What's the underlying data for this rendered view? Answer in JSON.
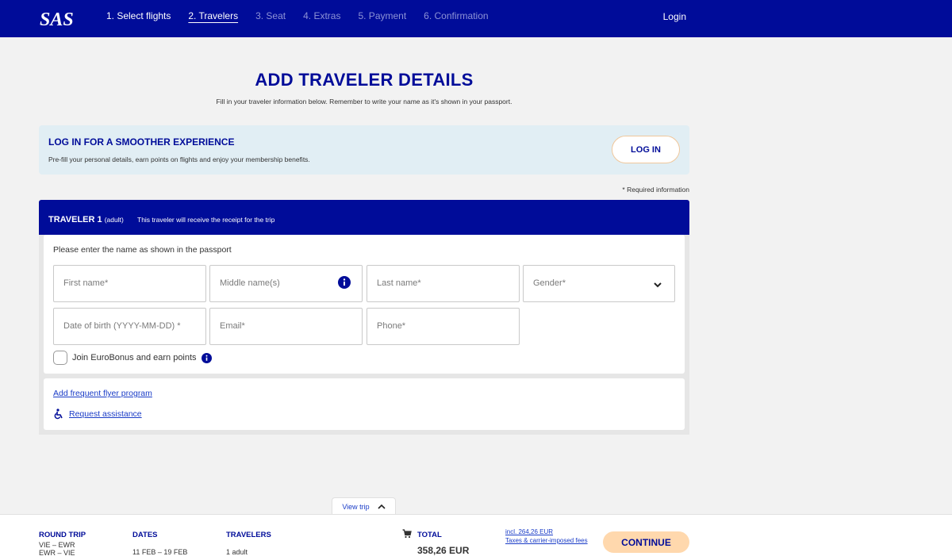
{
  "header": {
    "logo_text": "SAS",
    "steps": [
      {
        "label": "1. Select flights",
        "state": "done"
      },
      {
        "label": "2. Travelers",
        "state": "current"
      },
      {
        "label": "3. Seat",
        "state": "future"
      },
      {
        "label": "4. Extras",
        "state": "future"
      },
      {
        "label": "5. Payment",
        "state": "future"
      },
      {
        "label": "6. Confirmation",
        "state": "future"
      }
    ],
    "login_label": "Login"
  },
  "page": {
    "title": "ADD TRAVELER DETAILS",
    "subtitle": "Fill in your traveler information below. Remember to write your name as it's shown in your passport."
  },
  "login_banner": {
    "title": "LOG IN FOR A SMOOTHER EXPERIENCE",
    "text": "Pre-fill your personal details, earn points on flights and enjoy your membership benefits.",
    "button": "LOG IN"
  },
  "required_note": "* Required information",
  "traveler": {
    "title": "TRAVELER 1",
    "type": "(adult)",
    "note": "This traveler will receive the receipt for the trip",
    "hint": "Please enter the name as shown in the passport",
    "fields": {
      "first_name": "First name*",
      "middle_name": "Middle name(s)",
      "last_name": "Last name*",
      "gender": "Gender*",
      "dob": "Date of birth (YYYY-MM-DD) *",
      "email": "Email*",
      "phone": "Phone*"
    },
    "eurobonus_label": "Join EuroBonus and earn points",
    "frequent_flyer_link": "Add frequent flyer program",
    "assistance_link": "Request assistance"
  },
  "bottom_bar": {
    "view_trip": "View trip",
    "trip_label": "ROUND TRIP",
    "route_out": "VIE – EWR",
    "route_back": "EWR – VIE",
    "dates_label": "DATES",
    "dates_value": "11 FEB – 19 FEB",
    "travelers_label": "TRAVELERS",
    "travelers_value": "1 adult",
    "total_label": "TOTAL",
    "total_value": "358,26 EUR",
    "fees_amount": "incl. 264,26 EUR",
    "fees_label": "Taxes & carrier-imposed fees",
    "continue": "CONTINUE"
  },
  "colors": {
    "brand_blue": "#000c99",
    "banner_bg": "#e1eef4",
    "continue_bg": "#ffd8ad",
    "link_blue": "#1a3cc7"
  }
}
